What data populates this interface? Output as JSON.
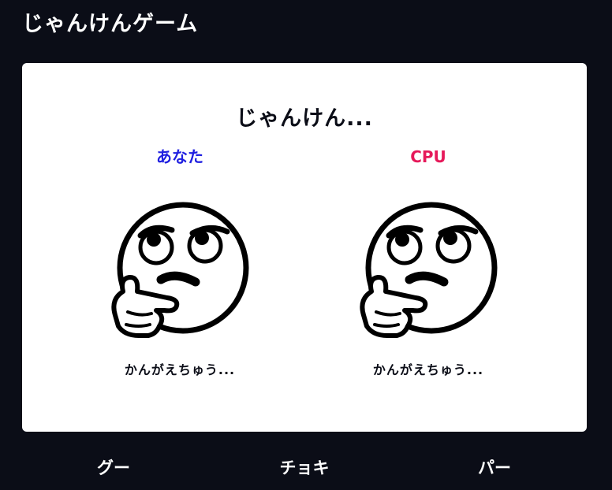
{
  "app": {
    "title": "じゃんけんゲーム"
  },
  "round": {
    "title": "じゃんけん..."
  },
  "players": {
    "you": {
      "name": "あなた",
      "name_color": "#1f1fe0",
      "face_icon": "thinking-face-icon",
      "status": "かんがえちゅう..."
    },
    "cpu": {
      "name": "CPU",
      "name_color": "#e6195a",
      "face_icon": "thinking-face-icon",
      "status": "かんがえちゅう..."
    }
  },
  "hands": {
    "rock": "グー",
    "scissors": "チョキ",
    "paper": "パー"
  },
  "colors": {
    "background": "#0b0d17",
    "panel": "#ffffff"
  }
}
